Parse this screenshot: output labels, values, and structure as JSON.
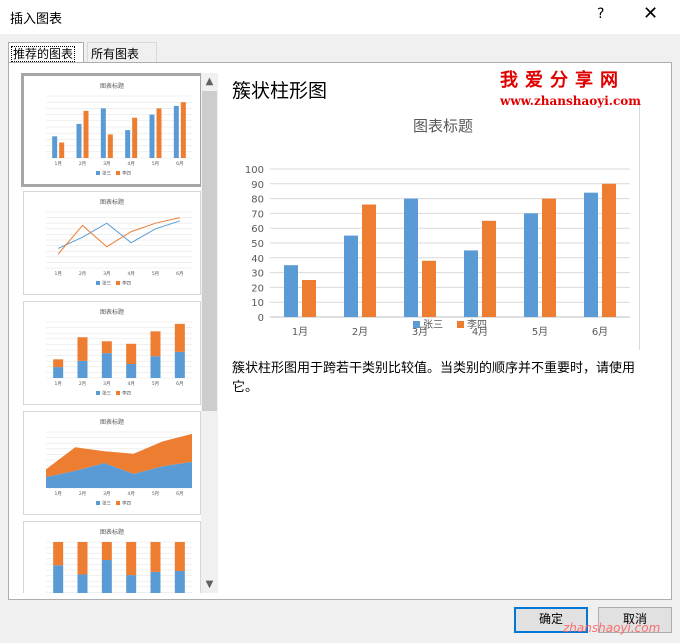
{
  "window": {
    "title": "插入图表",
    "help_label": "?",
    "close_label": "✕"
  },
  "tabs": [
    {
      "label": "推荐的图表"
    },
    {
      "label": "所有图表"
    }
  ],
  "watermark": {
    "text": "我爱分享网",
    "url": "www.zhanshaoyi.com"
  },
  "preview": {
    "heading": "簇状柱形图",
    "description": "簇状柱形图用于跨若干类别比较值。当类别的顺序并不重要时，请使用它。"
  },
  "chart_data": {
    "type": "bar",
    "title": "图表标题",
    "categories": [
      "1月",
      "2月",
      "3月",
      "4月",
      "5月",
      "6月"
    ],
    "series": [
      {
        "name": "张三",
        "values": [
          35,
          55,
          80,
          45,
          70,
          84
        ],
        "color": "#5b9bd5"
      },
      {
        "name": "李四",
        "values": [
          25,
          76,
          38,
          65,
          80,
          90
        ],
        "color": "#ed7d31"
      }
    ],
    "ylim": [
      0,
      100
    ],
    "yticks": [
      0,
      10,
      20,
      30,
      40,
      50,
      60,
      70,
      80,
      90,
      100
    ],
    "grid": true,
    "legend": "bottom"
  },
  "thumbnails": [
    {
      "kind": "clustered-column",
      "title": "图表标题"
    },
    {
      "kind": "line",
      "title": "图表标题"
    },
    {
      "kind": "stacked-column",
      "title": "图表标题"
    },
    {
      "kind": "stacked-area",
      "title": "图表标题"
    },
    {
      "kind": "percent-stacked-column",
      "title": "图表标题"
    }
  ],
  "buttons": {
    "ok": "确定",
    "cancel": "取消"
  },
  "footer_url": "zhanshaoyi.com",
  "scrollbar": {
    "up_icon": "▲",
    "down_icon": "▼"
  }
}
